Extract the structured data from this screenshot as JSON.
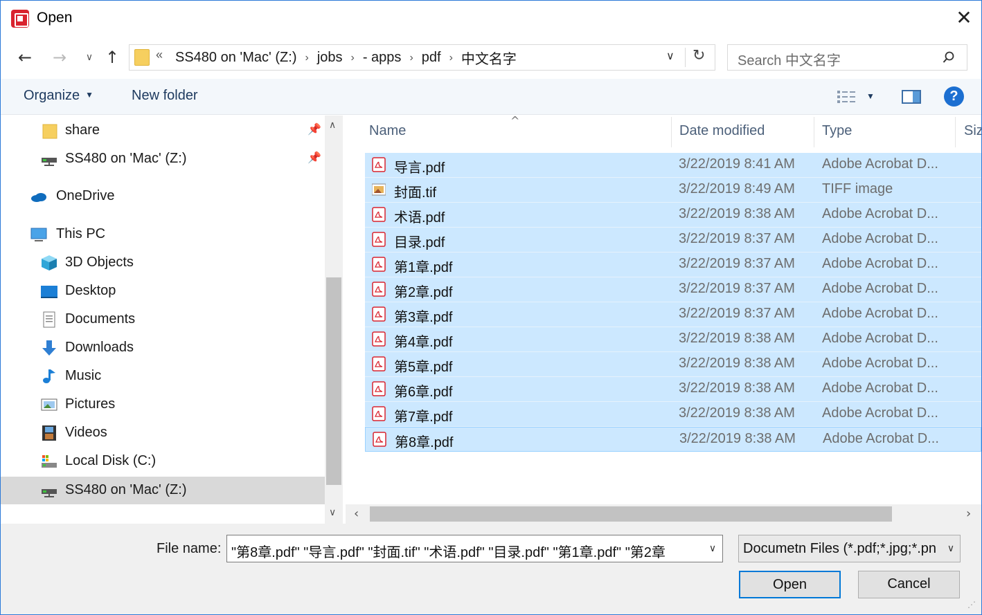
{
  "window": {
    "title": "Open"
  },
  "address": {
    "overflow": "«",
    "crumbs": [
      "SS480 on 'Mac' (Z:)",
      "jobs",
      "- apps",
      "pdf",
      "中文名字"
    ]
  },
  "search": {
    "placeholder": "Search 中文名字"
  },
  "toolbar": {
    "organize_label": "Organize",
    "new_folder_label": "New folder"
  },
  "nav": {
    "items": [
      {
        "label": "share",
        "icon": "folder-icon",
        "pinned": true
      },
      {
        "label": "SS480 on 'Mac' (Z:)",
        "icon": "network-drive-icon",
        "pinned": true
      },
      {
        "label": "OneDrive",
        "icon": "onedrive-icon"
      },
      {
        "label": "This PC",
        "icon": "computer-icon"
      },
      {
        "label": "3D Objects",
        "icon": "cube-icon"
      },
      {
        "label": "Desktop",
        "icon": "desktop-icon"
      },
      {
        "label": "Documents",
        "icon": "documents-icon"
      },
      {
        "label": "Downloads",
        "icon": "downloads-icon"
      },
      {
        "label": "Music",
        "icon": "music-icon"
      },
      {
        "label": "Pictures",
        "icon": "pictures-icon"
      },
      {
        "label": "Videos",
        "icon": "videos-icon"
      },
      {
        "label": "Local Disk (C:)",
        "icon": "local-disk-icon"
      },
      {
        "label": "SS480 on 'Mac' (Z:)",
        "icon": "network-drive-icon",
        "selected": true
      }
    ]
  },
  "columns": {
    "name": "Name",
    "date": "Date modified",
    "type": "Type",
    "size": "Siz"
  },
  "files": [
    {
      "name": "导言.pdf",
      "date": "3/22/2019 8:41 AM",
      "type": "Adobe Acrobat D...",
      "icon": "pdf-icon"
    },
    {
      "name": "封面.tif",
      "date": "3/22/2019 8:49 AM",
      "type": "TIFF image",
      "icon": "tif-icon"
    },
    {
      "name": "术语.pdf",
      "date": "3/22/2019 8:38 AM",
      "type": "Adobe Acrobat D...",
      "icon": "pdf-icon"
    },
    {
      "name": "目录.pdf",
      "date": "3/22/2019 8:37 AM",
      "type": "Adobe Acrobat D...",
      "icon": "pdf-icon"
    },
    {
      "name": "第1章.pdf",
      "date": "3/22/2019 8:37 AM",
      "type": "Adobe Acrobat D...",
      "icon": "pdf-icon"
    },
    {
      "name": "第2章.pdf",
      "date": "3/22/2019 8:37 AM",
      "type": "Adobe Acrobat D...",
      "icon": "pdf-icon"
    },
    {
      "name": "第3章.pdf",
      "date": "3/22/2019 8:37 AM",
      "type": "Adobe Acrobat D...",
      "icon": "pdf-icon"
    },
    {
      "name": "第4章.pdf",
      "date": "3/22/2019 8:38 AM",
      "type": "Adobe Acrobat D...",
      "icon": "pdf-icon"
    },
    {
      "name": "第5章.pdf",
      "date": "3/22/2019 8:38 AM",
      "type": "Adobe Acrobat D...",
      "icon": "pdf-icon"
    },
    {
      "name": "第6章.pdf",
      "date": "3/22/2019 8:38 AM",
      "type": "Adobe Acrobat D...",
      "icon": "pdf-icon"
    },
    {
      "name": "第7章.pdf",
      "date": "3/22/2019 8:38 AM",
      "type": "Adobe Acrobat D...",
      "icon": "pdf-icon"
    },
    {
      "name": "第8章.pdf",
      "date": "3/22/2019 8:38 AM",
      "type": "Adobe Acrobat D...",
      "icon": "pdf-icon"
    }
  ],
  "footer": {
    "file_name_label": "File name:",
    "file_name_value": "\"第8章.pdf\" \"导言.pdf\" \"封面.tif\" \"术语.pdf\" \"目录.pdf\" \"第1章.pdf\" \"第2章",
    "file_type_value": "Documetn Files (*.pdf;*.jpg;*.pn",
    "open_label": "Open",
    "cancel_label": "Cancel"
  },
  "colors": {
    "selection": "#cce8ff",
    "accent": "#0078d7",
    "pdf_red": "#d9232e"
  }
}
